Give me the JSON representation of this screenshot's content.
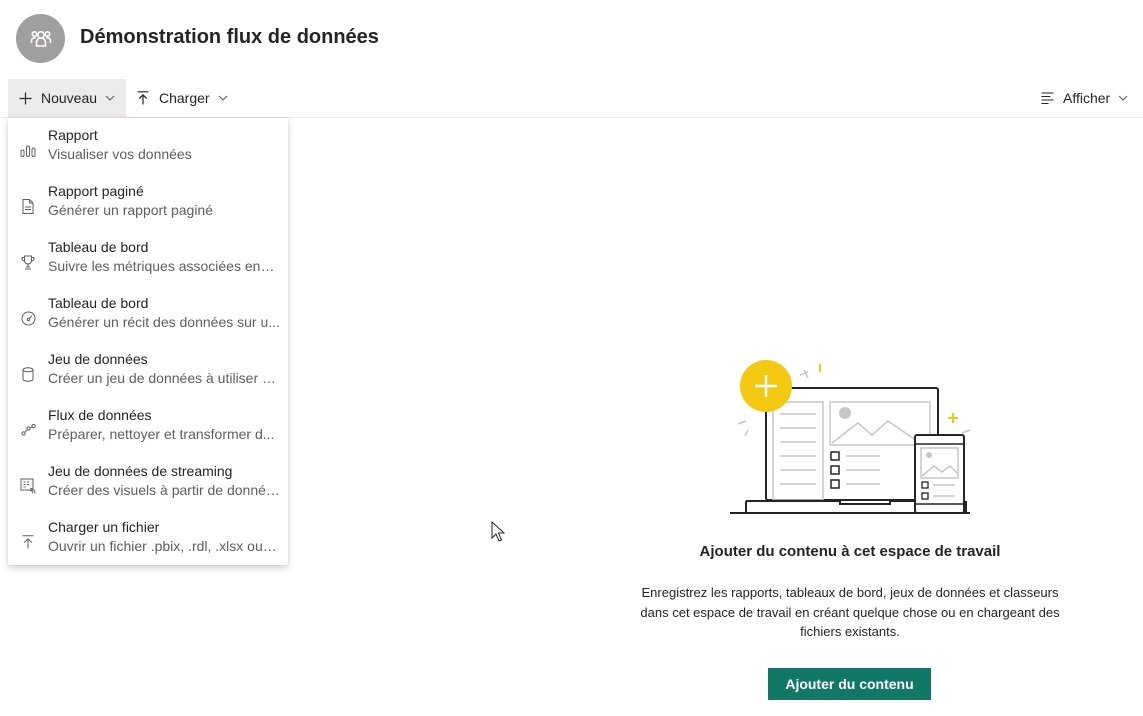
{
  "workspace": {
    "title": "Démonstration flux de données",
    "avatar_icon": "workspace-people-icon"
  },
  "toolbar": {
    "new_label": "Nouveau",
    "upload_label": "Charger",
    "view_label": "Afficher"
  },
  "new_menu": {
    "items": [
      {
        "icon": "report-icon",
        "title": "Rapport",
        "subtitle": "Visualiser vos données"
      },
      {
        "icon": "paginated-report-icon",
        "title": "Rapport paginé",
        "subtitle": "Générer un rapport paginé"
      },
      {
        "icon": "trophy-icon",
        "title": "Tableau de bord",
        "subtitle": "Suivre les métriques associées ense..."
      },
      {
        "icon": "gauge-icon",
        "title": "Tableau de bord",
        "subtitle": "Générer un récit des données sur u..."
      },
      {
        "icon": "dataset-icon",
        "title": "Jeu de données",
        "subtitle": "Créer un jeu de données à utiliser d..."
      },
      {
        "icon": "dataflow-icon",
        "title": "Flux de données",
        "subtitle": "Préparer, nettoyer et transformer d..."
      },
      {
        "icon": "streaming-dataset-icon",
        "title": "Jeu de données de streaming",
        "subtitle": "Créer des visuels à partir de donnée..."
      },
      {
        "icon": "upload-icon",
        "title": "Charger un fichier",
        "subtitle": "Ouvrir un fichier .pbix, .rdl, .xlsx ou ...."
      }
    ]
  },
  "empty_state": {
    "title": "Ajouter du contenu à cet espace de travail",
    "description": "Enregistrez les rapports, tableaux de bord, jeux de données et classeurs dans cet espace de travail en créant quelque chose ou en chargeant des fichiers existants.",
    "button_label": "Ajouter du contenu"
  },
  "colors": {
    "accent_button": "#117865",
    "illustration_yellow": "#f2c811",
    "avatar_bg": "#a19f9d"
  }
}
